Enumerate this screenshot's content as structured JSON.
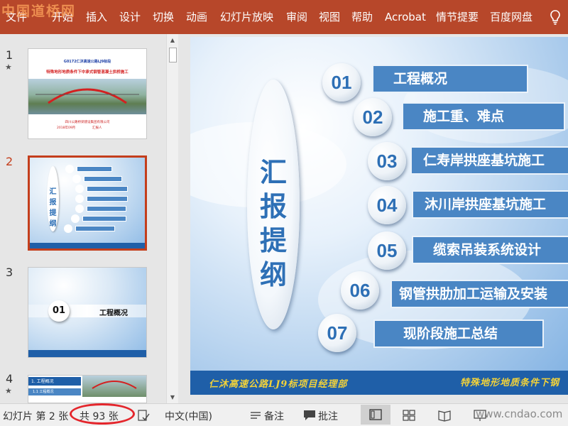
{
  "ribbon": {
    "tabs": [
      "文件",
      "开始",
      "插入",
      "设计",
      "切换",
      "动画",
      "幻灯片放映",
      "审阅",
      "视图",
      "帮助",
      "Acrobat",
      "情节提要",
      "百度网盘"
    ]
  },
  "watermark_top": "中国道桥网",
  "watermark_bottom": "www.cndao.com",
  "thumbnails": {
    "slides": [
      {
        "number": "1",
        "star": "★",
        "title_line1": "G0172仁沐高速公路LJ9标段",
        "title_line2": "特殊地形地质条件下中承式钢管混凝土拱桥施工",
        "org": "四川公路桥梁建设集团有限公司",
        "date": "2018年09月",
        "author": "汇报人"
      },
      {
        "number": "2",
        "oval_chars": [
          "汇",
          "报",
          "提",
          "纲"
        ]
      },
      {
        "number": "3",
        "item_number": "01",
        "item_label": "工程概况"
      },
      {
        "number": "4",
        "star": "★",
        "heading": "1. 工程概况",
        "subheading": "1.1 工程概况"
      }
    ]
  },
  "slide": {
    "oval_chars": [
      "汇",
      "报",
      "提",
      "纲"
    ],
    "items": [
      {
        "num": "01",
        "label": "工程概况"
      },
      {
        "num": "02",
        "label": "施工重、难点"
      },
      {
        "num": "03",
        "label": "仁寿岸拱座基坑施工"
      },
      {
        "num": "04",
        "label": "沐川岸拱座基坑施工"
      },
      {
        "num": "05",
        "label": "缆索吊装系统设计"
      },
      {
        "num": "06",
        "label": "钢管拱肋加工运输及安装"
      },
      {
        "num": "07",
        "label": "现阶段施工总结"
      }
    ],
    "footer_left": "仁沐高速公路LJ9标项目经理部",
    "footer_right": "特殊地形地质条件下钢"
  },
  "status": {
    "slide_pos": "幻灯片 第 2 张",
    "slide_total": "共 93 张",
    "language": "中文(中国)",
    "notes": "备注",
    "comments": "批注"
  },
  "colors": {
    "ribbon": "#b7472a",
    "selected_border": "#c43e1c",
    "item_box": "#4a86c4",
    "footer_bar": "#1f5fa8",
    "footer_text": "#f2d23a",
    "count_ring": "#e4262c"
  },
  "icons": {
    "ribbon_end": "lightbulb-icon",
    "status": [
      "spellcheck-icon",
      "notes-icon",
      "comment-icon",
      "normal-view-icon",
      "slide-sorter-icon",
      "reading-view-icon",
      "slideshow-icon"
    ]
  }
}
